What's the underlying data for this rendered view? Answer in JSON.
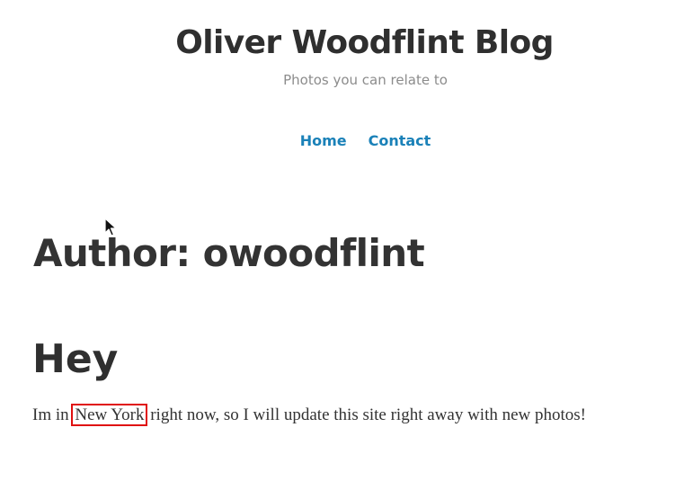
{
  "header": {
    "site_title": "Oliver Woodflint Blog",
    "tagline": "Photos you can relate to"
  },
  "nav": {
    "items": [
      {
        "label": "Home"
      },
      {
        "label": "Contact"
      }
    ],
    "link_color": "#1a81b8"
  },
  "archive": {
    "title": "Author: owoodflint"
  },
  "post": {
    "title": "Hey",
    "body_before": "Im in ",
    "body_highlight": "New York",
    "body_after": " right now, so I will update this site right away with new photos!",
    "highlight_color": "#e01010"
  },
  "cursor": {
    "icon": "mouse-pointer-icon"
  }
}
